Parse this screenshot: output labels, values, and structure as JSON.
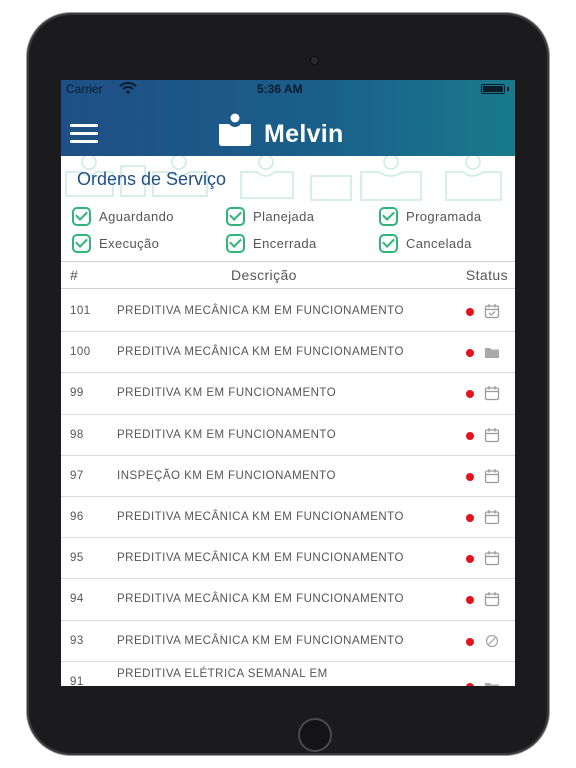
{
  "statusbar": {
    "carrier": "Carrier",
    "time": "5:36 AM"
  },
  "header": {
    "app_title": "Melvin",
    "menu_icon": "hamburger-menu-icon",
    "logo_icon": "melvin-logo-icon"
  },
  "page": {
    "title": "Ordens de Serviço"
  },
  "filters": [
    {
      "label": "Aguardando",
      "checked": true
    },
    {
      "label": "Planejada",
      "checked": true
    },
    {
      "label": "Programada",
      "checked": true
    },
    {
      "label": "Execução",
      "checked": true
    },
    {
      "label": "Encerrada",
      "checked": true
    },
    {
      "label": "Cancelada",
      "checked": true
    }
  ],
  "table": {
    "columns": {
      "number": "#",
      "description": "Descrição",
      "status": "Status"
    },
    "rows": [
      {
        "number": "101",
        "description": "PREDITIVA MECÂNICA KM EM FUNCIONAMENTO",
        "status_icon": "calendar-check-icon"
      },
      {
        "number": "100",
        "description": "PREDITIVA MECÂNICA KM EM FUNCIONAMENTO",
        "status_icon": "folder-icon"
      },
      {
        "number": "99",
        "description": "PREDITIVA  KM EM FUNCIONAMENTO",
        "status_icon": "calendar-icon"
      },
      {
        "number": "98",
        "description": "PREDITIVA  KM EM FUNCIONAMENTO",
        "status_icon": "calendar-icon"
      },
      {
        "number": "97",
        "description": "INSPEÇÃO  KM EM FUNCIONAMENTO",
        "status_icon": "calendar-icon"
      },
      {
        "number": "96",
        "description": "PREDITIVA MECÂNICA KM EM FUNCIONAMENTO",
        "status_icon": "calendar-icon"
      },
      {
        "number": "95",
        "description": "PREDITIVA MECÂNICA KM EM FUNCIONAMENTO",
        "status_icon": "calendar-icon"
      },
      {
        "number": "94",
        "description": "PREDITIVA MECÂNICA KM EM FUNCIONAMENTO",
        "status_icon": "calendar-icon"
      },
      {
        "number": "93",
        "description": "PREDITIVA MECÂNICA KM EM FUNCIONAMENTO",
        "status_icon": "cancelled-icon"
      },
      {
        "number": "91",
        "description": "PREDITIVA ELÉTRICA SEMANAL EM",
        "status_icon": "folder-icon"
      }
    ]
  },
  "colors": {
    "header_start": "#1f4f86",
    "header_end": "#197a8c",
    "check_green": "#31b47a",
    "status_dot_red": "#e3121c",
    "title_blue": "#1f4f86"
  }
}
